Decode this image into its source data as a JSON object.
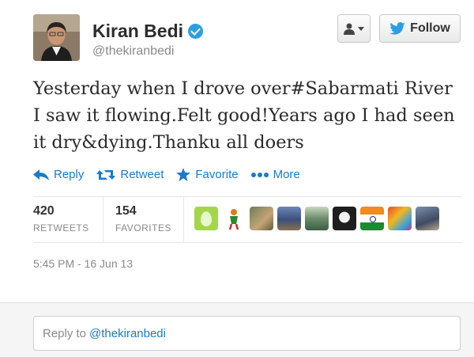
{
  "user": {
    "name": "Kiran Bedi",
    "handle": "@thekiranbedi"
  },
  "header": {
    "follow_label": "Follow"
  },
  "tweet": {
    "text": "Yesterday when I drove over#Sabarmati River I saw it flowing.Felt good!Years ago I had seen it dry&dying.Thanku all doers"
  },
  "actions": {
    "reply": "Reply",
    "retweet": "Retweet",
    "favorite": "Favorite",
    "more": "More"
  },
  "stats": {
    "retweets_count": "420",
    "retweets_label": "RETWEETS",
    "favorites_count": "154",
    "favorites_label": "FAVORITES"
  },
  "favoriters": [
    "egg-avatar",
    "figure-avatar",
    "face-avatar",
    "landscape-avatar",
    "lake-avatar",
    "dark-avatar",
    "flag-avatar",
    "colorful-avatar",
    "person-avatar"
  ],
  "timestamp": "5:45 PM - 16 Jun 13",
  "reply": {
    "prefix": "Reply to",
    "mention": "@thekiranbedi"
  },
  "colors": {
    "link": "#1a7bc9",
    "twitter_blue": "#2b9fe0",
    "verified": "#2b9fe0"
  }
}
